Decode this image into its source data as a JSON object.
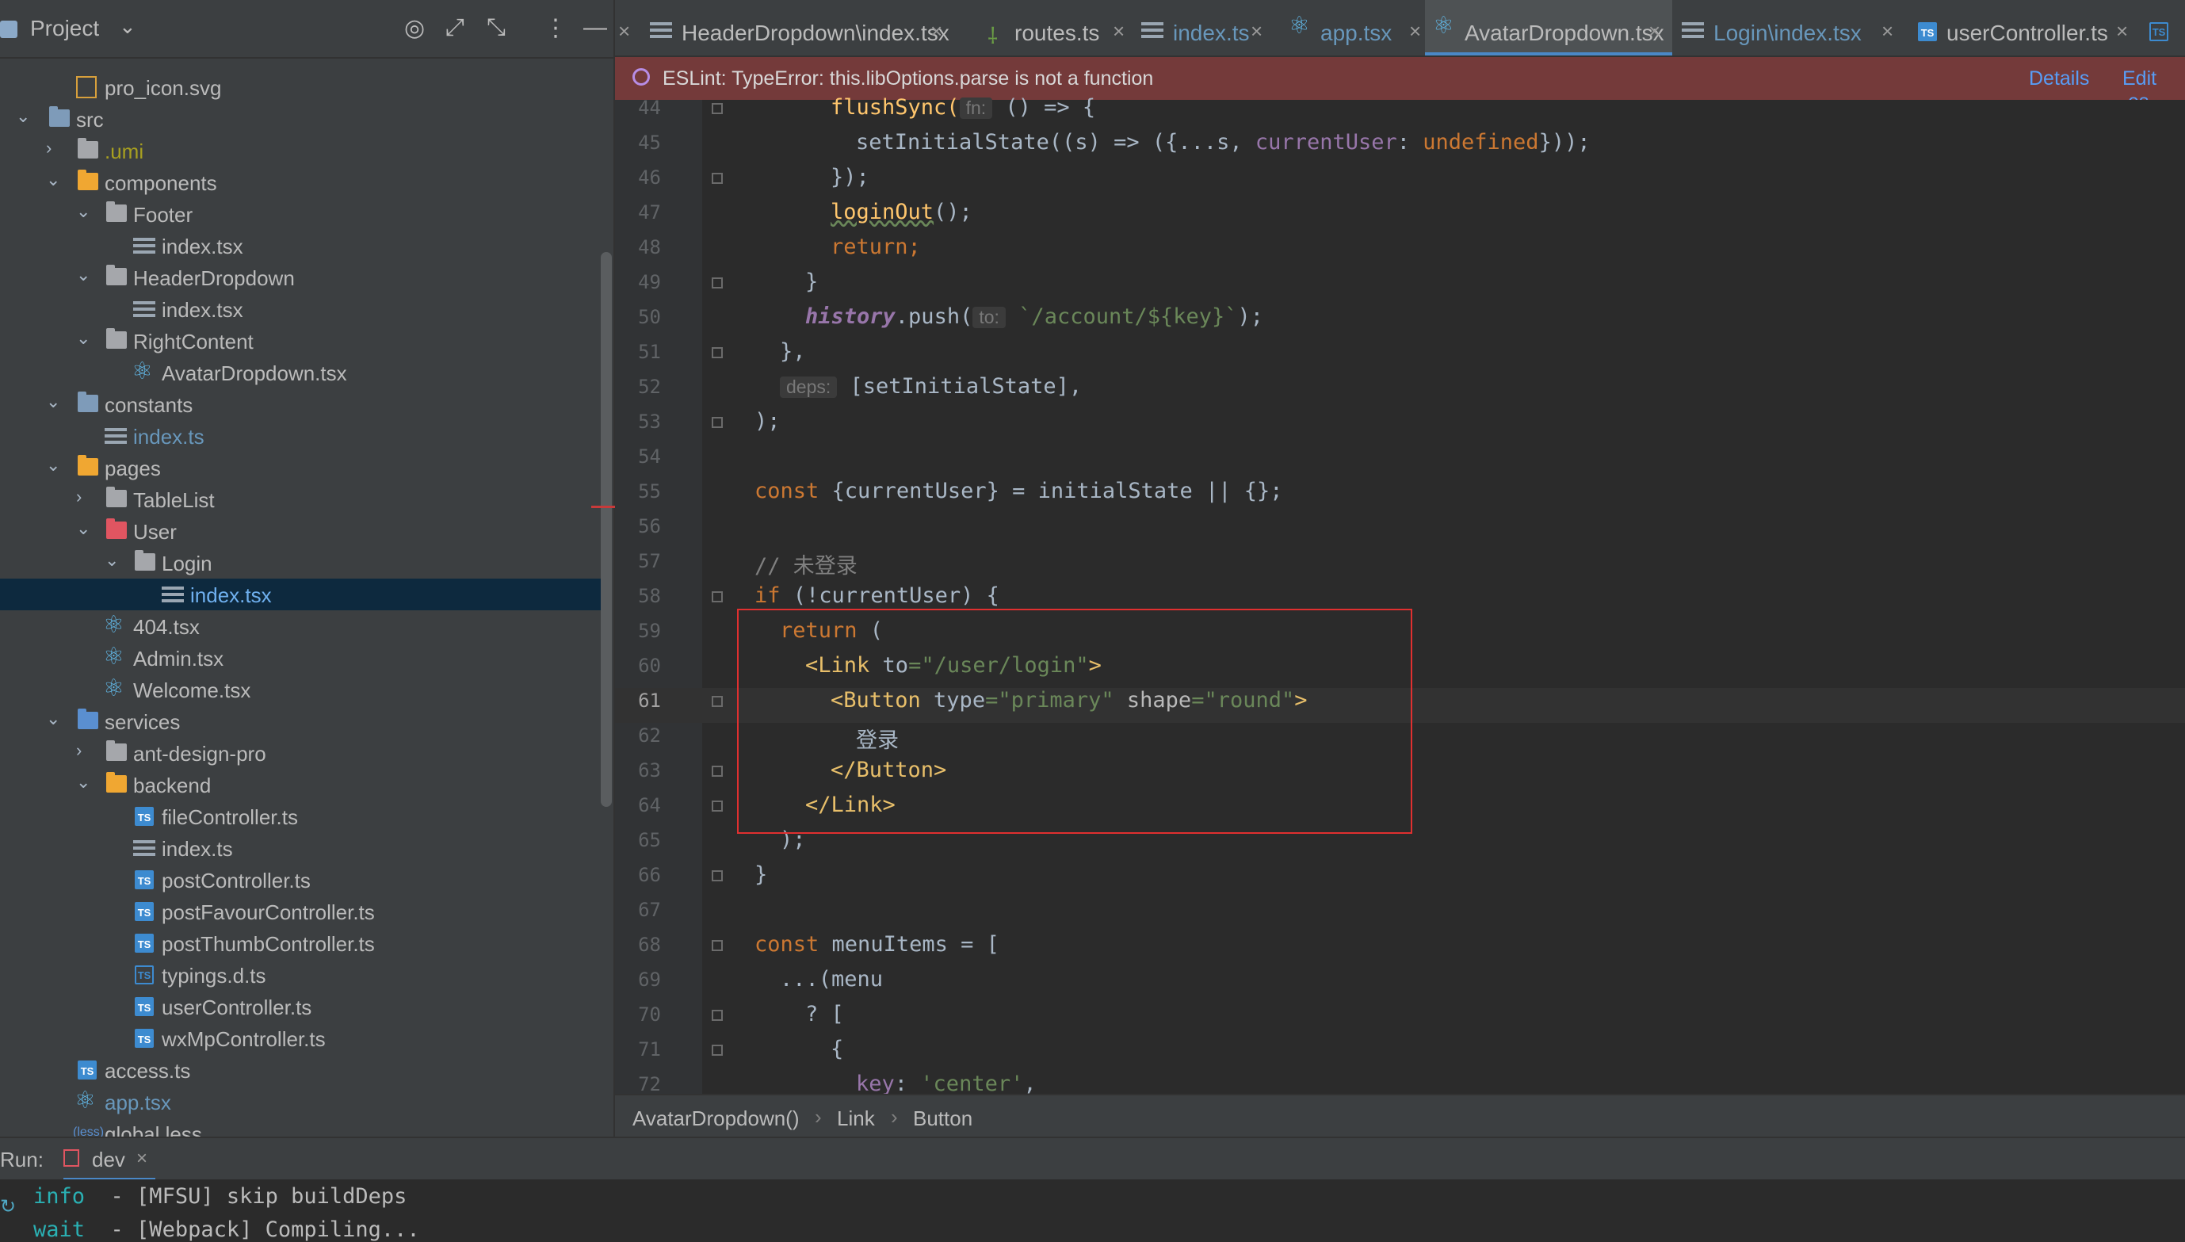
{
  "project_panel": {
    "title": "Project",
    "tree": [
      {
        "label": "pro_icon.svg",
        "icon": "svg-file-icon"
      },
      {
        "label": "src",
        "icon": "source-folder-icon"
      },
      {
        "label": ".umi",
        "icon": "folder-icon"
      },
      {
        "label": "components",
        "icon": "folder-icon"
      },
      {
        "label": "Footer",
        "icon": "folder-icon"
      },
      {
        "label": "index.tsx",
        "icon": "tsx-file-icon"
      },
      {
        "label": "HeaderDropdown",
        "icon": "folder-icon"
      },
      {
        "label": "index.tsx",
        "icon": "tsx-file-icon"
      },
      {
        "label": "RightContent",
        "icon": "folder-icon"
      },
      {
        "label": "AvatarDropdown.tsx",
        "icon": "react-file-icon"
      },
      {
        "label": "constants",
        "icon": "folder-icon"
      },
      {
        "label": "index.ts",
        "icon": "ts-file-icon"
      },
      {
        "label": "pages",
        "icon": "folder-icon"
      },
      {
        "label": "TableList",
        "icon": "folder-icon"
      },
      {
        "label": "User",
        "icon": "folder-icon"
      },
      {
        "label": "Login",
        "icon": "folder-icon"
      },
      {
        "label": "index.tsx",
        "icon": "tsx-file-icon"
      },
      {
        "label": "404.tsx",
        "icon": "react-file-icon"
      },
      {
        "label": "Admin.tsx",
        "icon": "react-file-icon"
      },
      {
        "label": "Welcome.tsx",
        "icon": "react-file-icon"
      },
      {
        "label": "services",
        "icon": "folder-icon"
      },
      {
        "label": "ant-design-pro",
        "icon": "folder-icon"
      },
      {
        "label": "backend",
        "icon": "folder-icon"
      },
      {
        "label": "fileController.ts",
        "icon": "ts-file-icon"
      },
      {
        "label": "index.ts",
        "icon": "ts-file-icon"
      },
      {
        "label": "postController.ts",
        "icon": "ts-file-icon"
      },
      {
        "label": "postFavourController.ts",
        "icon": "ts-file-icon"
      },
      {
        "label": "postThumbController.ts",
        "icon": "ts-file-icon"
      },
      {
        "label": "typings.d.ts",
        "icon": "ts-file-icon"
      },
      {
        "label": "userController.ts",
        "icon": "ts-file-icon"
      },
      {
        "label": "wxMpController.ts",
        "icon": "ts-file-icon"
      },
      {
        "label": "access.ts",
        "icon": "ts-file-icon"
      },
      {
        "label": "app.tsx",
        "icon": "react-file-icon"
      },
      {
        "label": "global.less",
        "icon": "less-file-icon"
      }
    ]
  },
  "tabs": [
    {
      "label": "HeaderDropdown\\index.tsx"
    },
    {
      "label": "routes.ts"
    },
    {
      "label": "index.ts"
    },
    {
      "label": "app.tsx"
    },
    {
      "label": "AvatarDropdown.tsx",
      "active": true
    },
    {
      "label": "Login\\index.tsx"
    },
    {
      "label": "userController.ts"
    }
  ],
  "eslint": {
    "message": "ESLint: TypeError: this.libOptions.parse is not a function",
    "details": "Details",
    "edit": "Edit .es"
  },
  "editor": {
    "line_numbers": [
      "44",
      "45",
      "46",
      "47",
      "48",
      "49",
      "50",
      "51",
      "52",
      "53",
      "54",
      "55",
      "56",
      "57",
      "58",
      "59",
      "60",
      "61",
      "62",
      "63",
      "64",
      "65",
      "66",
      "67",
      "68",
      "69",
      "70",
      "71",
      "72"
    ],
    "current_line": "61",
    "hints": {
      "fn": "fn:",
      "to": "to:",
      "deps": "deps:"
    },
    "lines": {
      "l44_a": "flushSync(",
      "l44_b": " () => {",
      "l45_a": "setInitialState((s) => ({...s, ",
      "l45_b": "currentUser",
      "l45_c": ": ",
      "l45_d": "undefined",
      "l45_e": "}));",
      "l46": "});",
      "l47_a": "loginOut",
      "l47_b": "();",
      "l48": "return;",
      "l49": "}",
      "l50_a": "history",
      "l50_b": ".push(",
      "l50_c": " `/account/${key}`",
      "l50_d": ");",
      "l51": "},",
      "l52_b": " [setInitialState],",
      "l53": ");",
      "l55_a": "const ",
      "l55_b": "{currentUser} = initialState || {};",
      "l57": "// 未登录",
      "l58_a": "if ",
      "l58_b": "(!currentUser) {",
      "l59_a": "return ",
      "l59_b": "(",
      "l60_a": "<Link ",
      "l60_b": "to",
      "l60_c": "=\"/user/login\"",
      "l60_d": ">",
      "l61_a": "<Button ",
      "l61_b": "type",
      "l61_c": "=\"primary\"",
      "l61_d": " shape",
      "l61_e": "=\"round\"",
      "l61_f": ">",
      "l62": "登录",
      "l63": "</Button>",
      "l64": "</Link>",
      "l65": ");",
      "l66": "}",
      "l68_a": "const ",
      "l68_b": "menuItems = [",
      "l69": "...(menu",
      "l70": "? [",
      "l71": "{",
      "l72_a": "key",
      "l72_b": ": ",
      "l72_c": "'center'",
      "l72_d": ","
    }
  },
  "breadcrumb": [
    "AvatarDropdown()",
    "Link",
    "Button"
  ],
  "run": {
    "label": "Run:",
    "tab": "dev",
    "console": [
      {
        "level": "info",
        "text": "  - [MFSU] skip buildDeps"
      },
      {
        "level": "wait",
        "text": "  - [Webpack] Compiling..."
      }
    ]
  },
  "colors": {
    "accent": "#4a88c7",
    "error_bar": "#743a3a",
    "highlight_box": "#e03030"
  }
}
